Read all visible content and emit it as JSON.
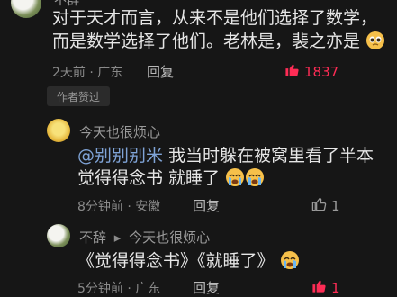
{
  "comment_top": {
    "author_partial": "不群",
    "line1": "对于天才而言，从来不是他们选择了数学，",
    "line2": "而是数学选择了他们。老林是，裴之亦是",
    "time_location": "2天前 · 广东",
    "reply_label": "回复",
    "like_count": "1837",
    "liked": true,
    "badge": "作者赞过",
    "accent_like_color": "#fe2c55"
  },
  "reply1": {
    "author": "今天也很烦心",
    "mention": "@别别别米",
    "line1_text": " 我当时躲在被窝里看了半本",
    "line2_text": "觉得得念书 就睡了",
    "time_location": "8分钟前 · 安徽",
    "reply_label": "回复",
    "like_count": "1",
    "liked": false
  },
  "reply2": {
    "author": "不辞",
    "reply_to": "今天也很烦心",
    "text": "《觉得得念书》《就睡了》",
    "time_location": "5分钟前 · 广东",
    "reply_label": "回复",
    "like_count": "1",
    "liked": true
  }
}
